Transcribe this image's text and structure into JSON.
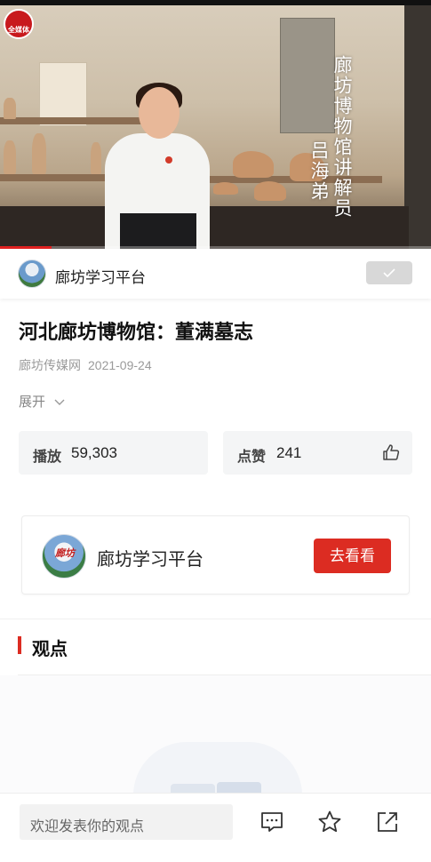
{
  "video": {
    "overlay_text": [
      "廊坊博物馆讲解员",
      "吕海弟"
    ],
    "logo_text": "全媒体",
    "progress_fraction": 0.12
  },
  "channel": {
    "name": "廊坊学习平台",
    "follow_icon": "check-icon"
  },
  "article": {
    "title": "河北廊坊博物馆：董满墓志",
    "source": "廊坊传媒网",
    "date": "2021-09-24",
    "expand_label": "展开"
  },
  "stats": {
    "play_label": "播放",
    "play_count": "59,303",
    "like_label": "点赞",
    "like_count": "241"
  },
  "channel_card": {
    "name": "廊坊学习平台",
    "avatar_text": "廊坊",
    "button_label": "去看看"
  },
  "comments": {
    "section_title": "观点",
    "input_placeholder": "欢迎发表你的观点"
  },
  "bottom_icons": [
    "comment-icon",
    "star-icon",
    "share-icon"
  ],
  "colors": {
    "accent_red": "#dc2c22"
  }
}
